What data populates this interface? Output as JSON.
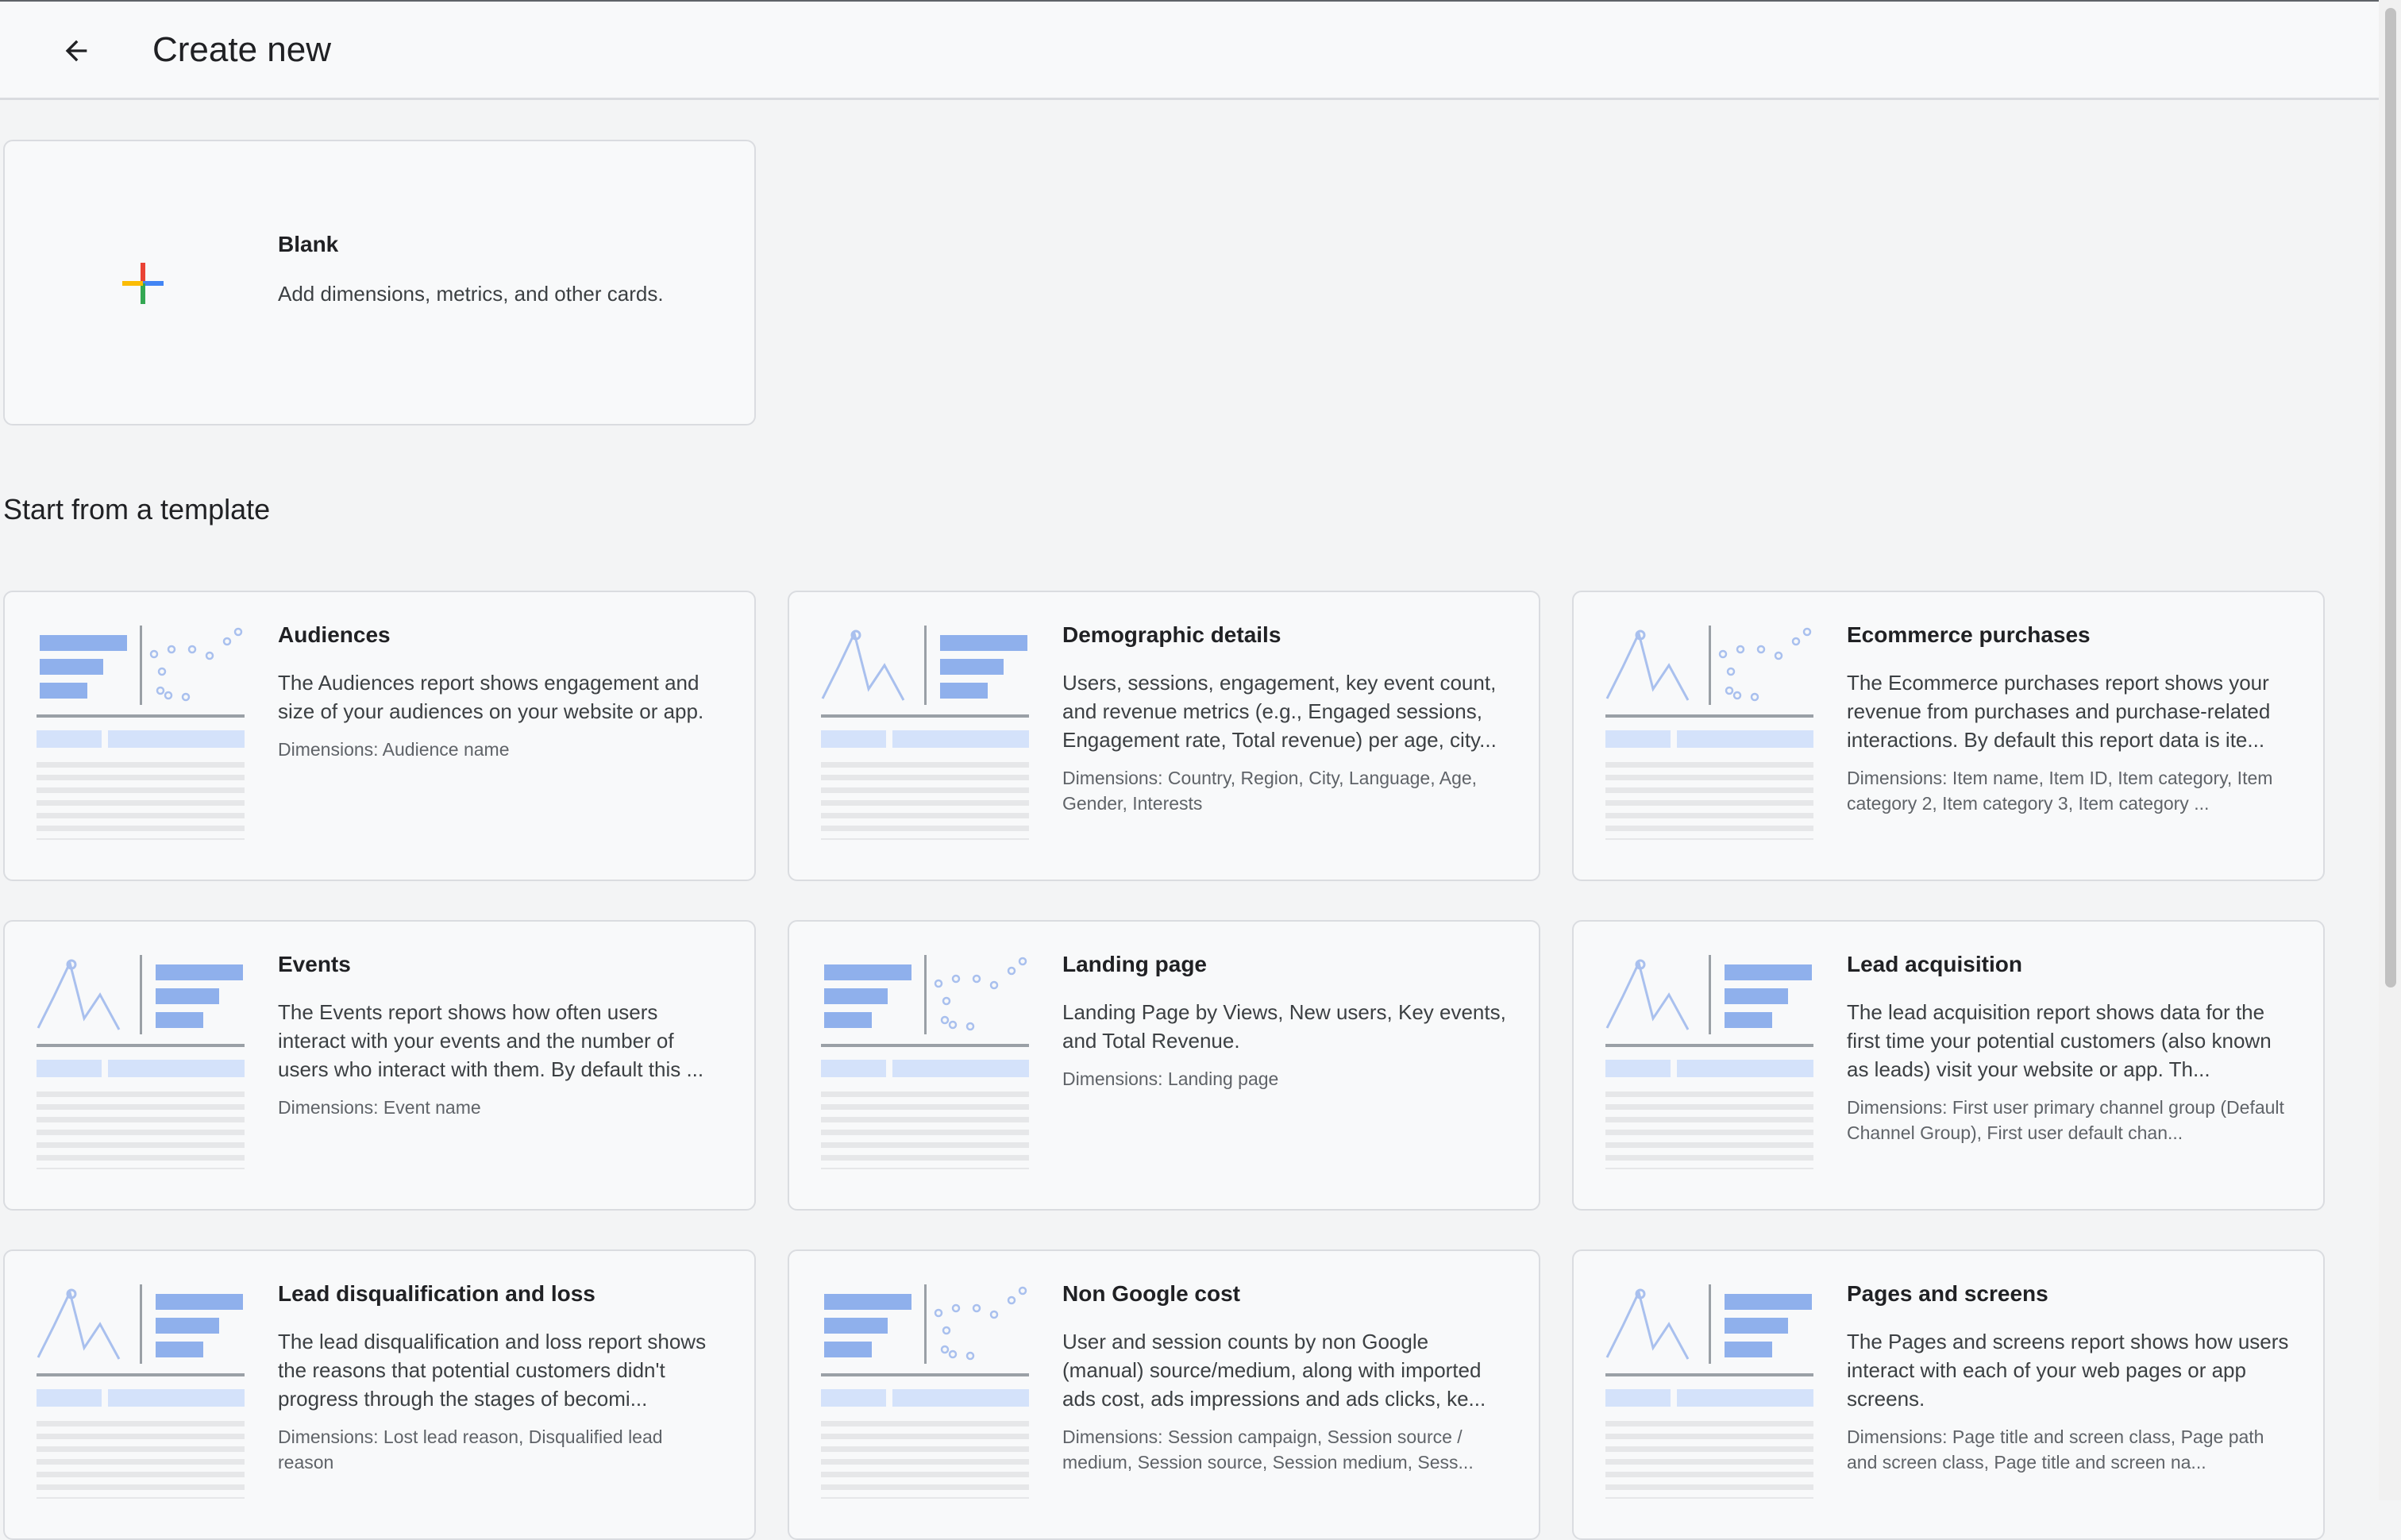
{
  "header": {
    "back_icon": "arrow-left-icon",
    "title": "Create new"
  },
  "blank_card": {
    "icon": "plus-icon",
    "icon_colors": [
      "#ea4335",
      "#4285f4",
      "#34a853",
      "#fbbc04"
    ],
    "title": "Blank",
    "description": "Add dimensions, metrics, and other cards."
  },
  "section": {
    "heading": "Start from a template"
  },
  "templates": [
    {
      "title": "Audiences",
      "description": "The Audiences report shows engagement and size of your audiences on your website or app.",
      "dimensions": "Dimensions: Audience name",
      "thumbnail": "bars-scatter"
    },
    {
      "title": "Demographic details",
      "description": "Users, sessions, engagement, key event count, and revenue metrics (e.g., Engaged sessions, Engagement rate, Total revenue) per age, city...",
      "dimensions": "Dimensions: Country, Region, City, Language, Age, Gender, Interests",
      "thumbnail": "line-bars"
    },
    {
      "title": "Ecommerce purchases",
      "description": "The Ecommerce purchases report shows your revenue from purchases and purchase-related interactions. By default this report data is ite...",
      "dimensions": "Dimensions: Item name, Item ID, Item category, Item category 2, Item category 3, Item category ...",
      "thumbnail": "line-scatter"
    },
    {
      "title": "Events",
      "description": "The Events report shows how often users interact with your events and the number of users who interact with them. By default this ...",
      "dimensions": "Dimensions: Event name",
      "thumbnail": "line-bars"
    },
    {
      "title": "Landing page",
      "description": "Landing Page by Views, New users, Key events, and Total Revenue.",
      "dimensions": "Dimensions: Landing page",
      "thumbnail": "bars-scatter"
    },
    {
      "title": "Lead acquisition",
      "description": "The lead acquisition report shows data for the first time your potential customers (also known as leads) visit your website or app. Th...",
      "dimensions": "Dimensions: First user primary channel group (Default Channel Group), First user default chan...",
      "thumbnail": "line-bars"
    },
    {
      "title": "Lead disqualification and loss",
      "description": "The lead disqualification and loss report shows the reasons that potential customers didn't progress through the stages of becomi...",
      "dimensions": "Dimensions: Lost lead reason, Disqualified lead reason",
      "thumbnail": "line-bars"
    },
    {
      "title": "Non Google cost",
      "description": "User and session counts by non Google (manual) source/medium, along with imported ads cost, ads impressions and ads clicks, ke...",
      "dimensions": "Dimensions: Session campaign, Session source / medium, Session source, Session medium, Sess...",
      "thumbnail": "bars-scatter"
    },
    {
      "title": "Pages and screens",
      "description": "The Pages and screens report shows how users interact with each of your web pages or app screens.",
      "dimensions": "Dimensions: Page title and screen class, Page path and screen class, Page title and screen na...",
      "thumbnail": "line-bars"
    }
  ],
  "colors": {
    "thumb_bar_dark": "#8fb0ec",
    "thumb_bar_light": "#d4e2fa",
    "thumb_line": "#a9c0ee",
    "thumb_axis": "#9aa0a6",
    "thumb_row": "#e6e7e9"
  }
}
